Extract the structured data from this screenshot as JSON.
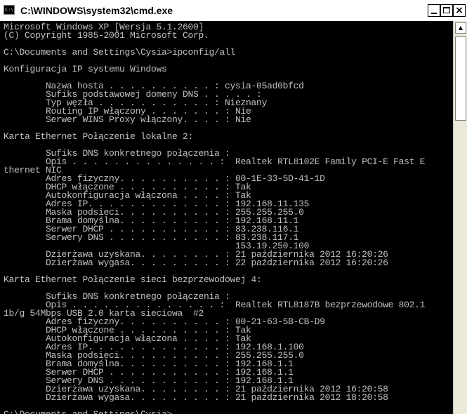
{
  "window": {
    "title": "C:\\WINDOWS\\system32\\cmd.exe",
    "app_icon": "C:\\",
    "close_glyph": "×"
  },
  "scrollbar": {
    "up_arrow": "▲"
  },
  "console": {
    "lines": [
      "Microsoft Windows XP [Wersja 5.1.2600]",
      "(C) Copyright 1985-2001 Microsoft Corp.",
      "",
      "C:\\Documents and Settings\\Cysia>ipconfig/all",
      "",
      "Konfiguracja IP systemu Windows",
      "",
      "        Nazwa hosta . . . . . . . . . . : cysia-05ad0bfcd",
      "        Sufiks podstawowej domeny DNS . . . . . :",
      "        Typ węzła . . . . . . . . . . . : Nieznany",
      "        Routing IP włączony . . . . . . . : Nie",
      "        Serwer WINS Proxy włączony. . . . : Nie",
      "",
      "Karta Ethernet Połączenie lokalne 2:",
      "",
      "        Sufiks DNS konkretnego połączenia :",
      "        Opis . . . . . . . . . . . . . . :  Realtek RTL8102E Family PCI-E Fast E",
      "thernet NIC",
      "        Adres fizyczny. . . . . . . . . . : 00-1E-33-5D-41-1D",
      "        DHCP włączone . . . . . . . . . . : Tak",
      "        Autokonfiguracja włączona . . . . : Tak",
      "        Adres IP. . . . . . . . . . . . . : 192.168.11.135",
      "        Maska podsieci. . . . . . . . . . : 255.255.255.0",
      "        Brama domyślna. . . . . . . . . . : 192.168.11.1",
      "        Serwer DHCP . . . . . . . . . . . : 83.238.116.1",
      "        Serwery DNS . . . . . . . . . . . : 83.238.117.1",
      "                                            153.19.250.100",
      "        Dzierżawa uzyskana. . . . . . . . : 21 października 2012 16:20:26",
      "        Dzierżawa wygasa. . . . . . . . . : 22 października 2012 16:20:26",
      "",
      "Karta Ethernet Połączenie sieci bezprzewodowej 4:",
      "",
      "        Sufiks DNS konkretnego połączenia :",
      "        Opis . . . . . . . . . . . . . . :  Realtek RTL8187B bezprzewodowe 802.1",
      "1b/g 54Mbps USB 2.0 karta sieciowa  #2",
      "        Adres fizyczny. . . . . . . . . . : 00-21-63-5B-CB-D9",
      "        DHCP włączone . . . . . . . . . . : Tak",
      "        Autokonfiguracja włączona . . . . : Tak",
      "        Adres IP. . . . . . . . . . . . . : 192.168.1.100",
      "        Maska podsieci. . . . . . . . . . : 255.255.255.0",
      "        Brama domyślna. . . . . . . . . . : 192.168.1.1",
      "        Serwer DHCP . . . . . . . . . . . : 192.168.1.1",
      "        Serwery DNS . . . . . . . . . . . : 192.168.1.1",
      "        Dzierżawa uzyskana. . . . . . . . : 21 października 2012 16:20:58",
      "        Dzierżawa wygasa. . . . . . . . . : 21 października 2012 18:20:58",
      "",
      "C:\\Documents and Settings\\Cysia>"
    ]
  }
}
